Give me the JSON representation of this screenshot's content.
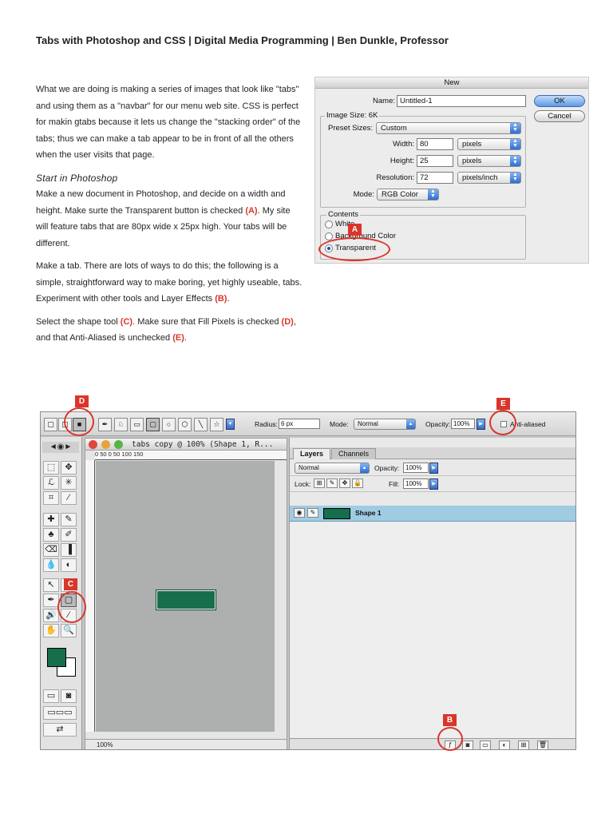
{
  "title": "Tabs with Photoshop and CSS | Digital Media Programming | Ben Dunkle, Professor",
  "text": {
    "p1": "What we are doing is making a series of images that look like \"tabs\" and using them as a \"navbar\" for our menu web site. CSS is perfect for makin gtabs because it lets us change the \"stacking order\" of the tabs; thus we can make a tab appear to be in front of all the others when the user visits that page.",
    "subhead": "Start in Photoshop",
    "p2_a": "Make a new document in Photoshop, and decide on a width and height. Make surte the Transparent button is checked ",
    "p2_ref": "(A)",
    "p2_b": ". My site will feature tabs that are 80px wide x 25px high. Your tabs will be different.",
    "p3_a": "Make a tab. There are lots of ways to do this; the following is a simple, straightforward way to make boring, yet highly useable, tabs. Experiment with other tools and Layer Effects ",
    "p3_ref": "(B)",
    "p3_b": ".",
    "p4_a": "Select the shape tool ",
    "p4_ref1": "(C)",
    "p4_b": ". Make sure that Fill Pixels is checked ",
    "p4_ref2": "(D)",
    "p4_c": ", and that Anti-Aliased is unchecked ",
    "p4_ref3": "(E)",
    "p4_d": "."
  },
  "dialog": {
    "title": "New",
    "name_label": "Name:",
    "name_value": "Untitled-1",
    "image_size": "Image Size: 6K",
    "preset_label": "Preset Sizes:",
    "preset_value": "Custom",
    "width_label": "Width:",
    "width_value": "80",
    "width_unit": "pixels",
    "height_label": "Height:",
    "height_value": "25",
    "height_unit": "pixels",
    "resolution_label": "Resolution:",
    "resolution_value": "72",
    "resolution_unit": "pixels/inch",
    "mode_label": "Mode:",
    "mode_value": "RGB Color",
    "ok": "OK",
    "cancel": "Cancel",
    "contents_label": "Contents",
    "opt_white": "White",
    "opt_background": "Background Color",
    "opt_transparent": "Transparent"
  },
  "callouts": {
    "a": "A",
    "b": "B",
    "c": "C",
    "d": "D",
    "e": "E"
  },
  "photoshop": {
    "radius_label": "Radius:",
    "radius_value": "6 px",
    "mode_label": "Mode:",
    "mode_value": "Normal",
    "opacity_label": "Opacity:",
    "opacity_value": "100%",
    "antialiased_label": "Anti-aliased",
    "doc_title": "tabs copy @ 100% (Shape 1, R...",
    "zoom": "100%",
    "ruler_top": "0     50     0     50     100    150",
    "layers_tab": "Layers",
    "channels_tab": "Channels",
    "blend_value": "Normal",
    "layers_opacity_label": "Opacity:",
    "layers_opacity_value": "100%",
    "lock_label": "Lock:",
    "fill_label": "Fill:",
    "fill_value": "100%",
    "layer_name": "Shape 1",
    "foreground_color": "#166e4c",
    "background_color": "#ffffff"
  }
}
